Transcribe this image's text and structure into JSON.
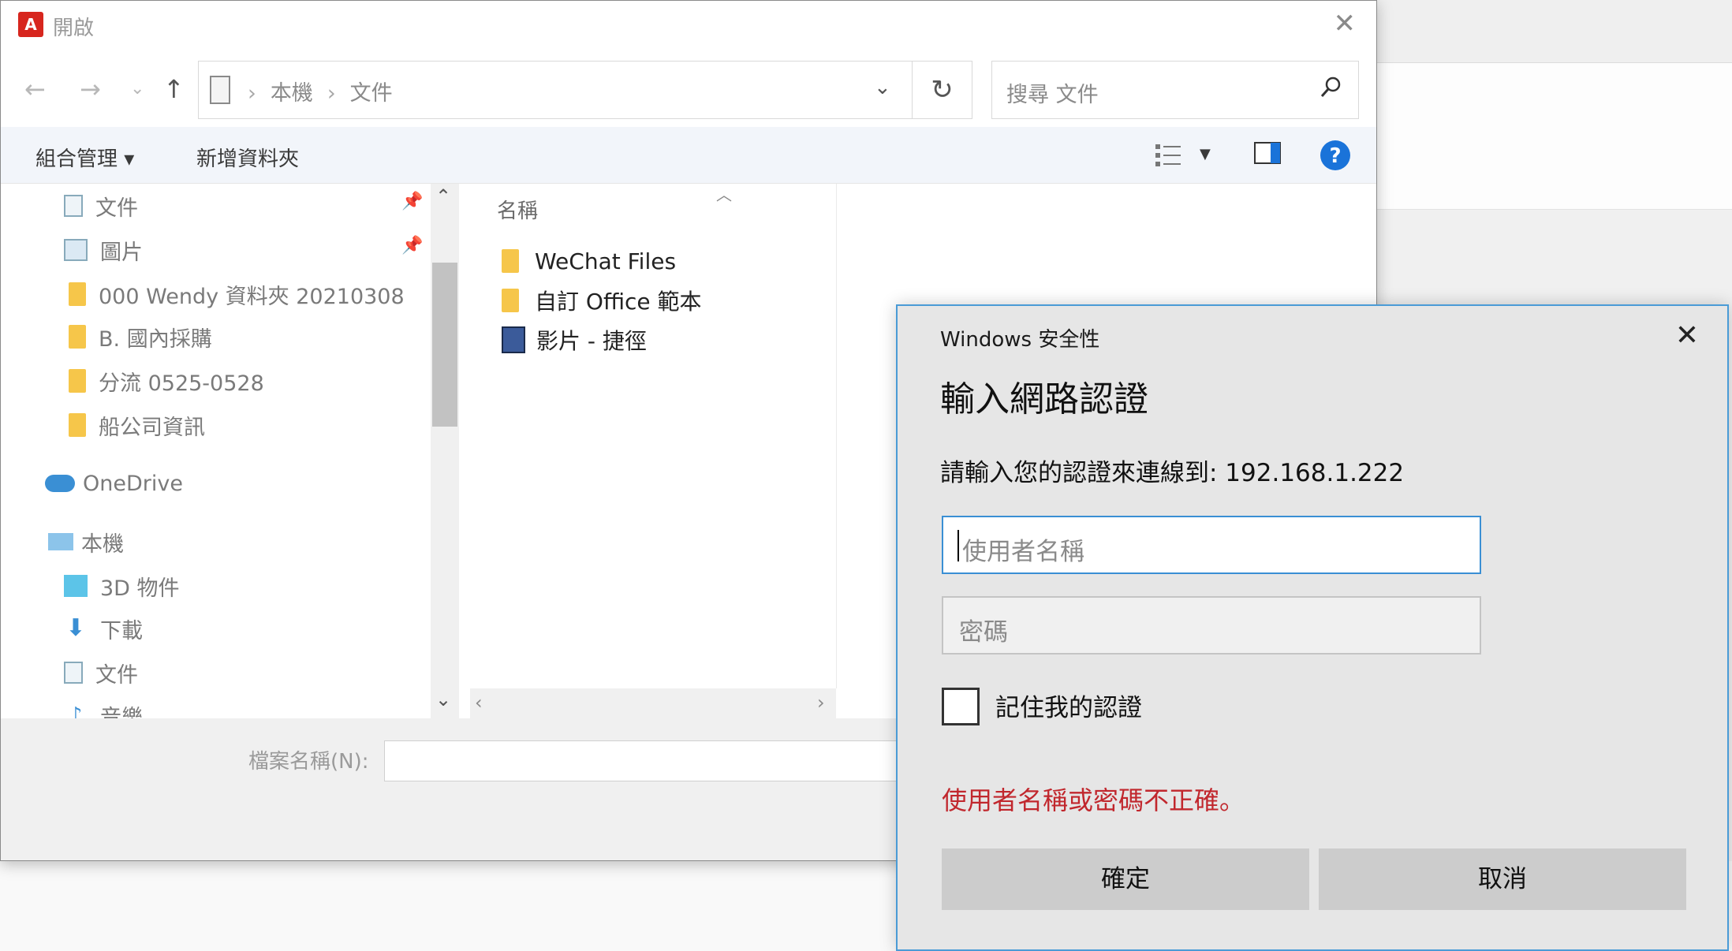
{
  "open_dialog": {
    "title": "開啟",
    "breadcrumb": [
      "本機",
      "文件"
    ],
    "search_placeholder": "搜尋 文件",
    "toolbar": {
      "organize": "組合管理 ▾",
      "new_folder": "新增資料夾"
    },
    "nav_items": [
      {
        "label": "文件",
        "icon": "document-icon",
        "pinned": true
      },
      {
        "label": "圖片",
        "icon": "pictures-icon",
        "pinned": true
      },
      {
        "label": "000 Wendy 資料夾 20210308",
        "icon": "folder-icon"
      },
      {
        "label": "B. 國內採購",
        "icon": "folder-icon"
      },
      {
        "label": "分流 0525-0528",
        "icon": "folder-icon"
      },
      {
        "label": "船公司資訊",
        "icon": "folder-icon"
      },
      {
        "label": "OneDrive",
        "icon": "onedrive-icon"
      },
      {
        "label": "本機",
        "icon": "computer-icon"
      },
      {
        "label": "3D 物件",
        "icon": "3d-objects-icon"
      },
      {
        "label": "下載",
        "icon": "download-icon"
      },
      {
        "label": "文件",
        "icon": "document-icon"
      },
      {
        "label": "音樂",
        "icon": "music-icon"
      }
    ],
    "column_header": "名稱",
    "files": [
      {
        "name": "WeChat Files",
        "icon": "folder-icon"
      },
      {
        "name": "自訂 Office 範本",
        "icon": "folder-icon"
      },
      {
        "name": "影片 - 捷徑",
        "icon": "video-shortcut-icon"
      }
    ],
    "filename_label": "檔案名稱(N):"
  },
  "credential_dialog": {
    "brand": "Windows 安全性",
    "title": "輸入網路認證",
    "message": "請輸入您的認證來連線到: 192.168.1.222",
    "username_placeholder": "使用者名稱",
    "password_placeholder": "密碼",
    "remember_label": "記住我的認證",
    "error": "使用者名稱或密碼不正確。",
    "ok_label": "確定",
    "cancel_label": "取消"
  },
  "colors": {
    "accent": "#3a8fd4",
    "error": "#c1272d",
    "folder": "#f6c64a",
    "help": "#1a73d9"
  }
}
